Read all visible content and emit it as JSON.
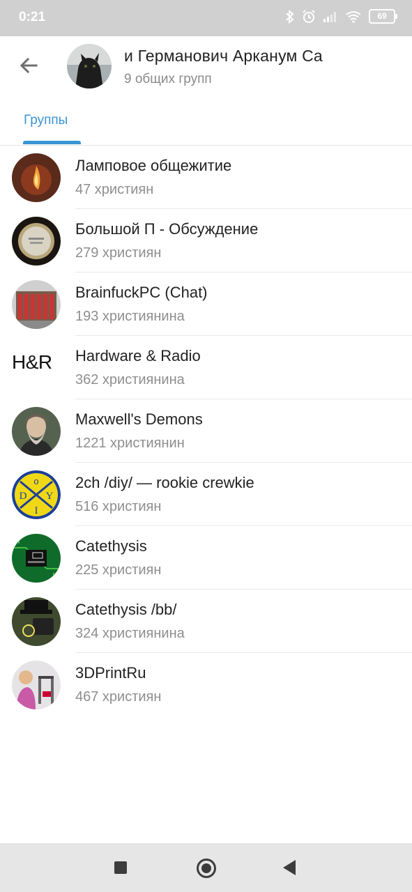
{
  "status_bar": {
    "time": "0:21",
    "battery": "69"
  },
  "header": {
    "title": "и Германович Арканум   Ca",
    "subtitle": "9 общих групп",
    "tab": "Группы"
  },
  "groups": [
    {
      "name": "Ламповое общежитие",
      "members": "47 християн"
    },
    {
      "name": "Большой П - Обсуждение",
      "members": "279 християн"
    },
    {
      "name": "BrainfuckPC (Chat)",
      "members": "193 християнина"
    },
    {
      "name": "Hardware & Radio",
      "members": "362 християнина",
      "avatar_text": "H&R"
    },
    {
      "name": "Maxwell's Demons",
      "members": "1221 християнин"
    },
    {
      "name": "2ch /diy/ — rookie crewkie",
      "members": "516 християн"
    },
    {
      "name": "Catethysis",
      "members": "225 християн"
    },
    {
      "name": "Catethysis /bb/",
      "members": "324 християнина"
    },
    {
      "name": "3DPrintRu",
      "members": "467 християн"
    }
  ],
  "colors": {
    "accent": "#3a95d5"
  }
}
